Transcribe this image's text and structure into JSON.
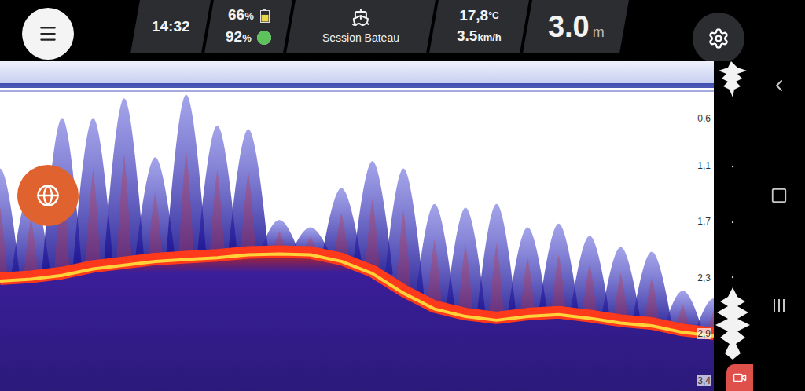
{
  "status_bar": {
    "time": "14:32",
    "phone_battery": {
      "value": "66",
      "unit": "%",
      "level": 0.66,
      "color": "#e8d44d"
    },
    "sonar_battery": {
      "value": "92",
      "unit": "%",
      "level": 0.92,
      "color": "#5cc25a"
    },
    "session": {
      "label": "Session Bateau"
    },
    "temperature": {
      "value": "17,8",
      "unit": "°C"
    },
    "speed": {
      "value": "3.5",
      "unit": "km/h"
    },
    "depth": {
      "value": "3.0",
      "unit": "m"
    }
  },
  "sonar": {
    "depth_scale": [
      "0,6",
      "1,1",
      "1,7",
      "2,3",
      "2,9",
      "3,4"
    ],
    "bottom": [
      2.31,
      2.29,
      2.25,
      2.18,
      2.14,
      2.1,
      2.08,
      2.06,
      2.03,
      2.02,
      2.03,
      2.1,
      2.23,
      2.44,
      2.61,
      2.69,
      2.73,
      2.69,
      2.67,
      2.71,
      2.76,
      2.79,
      2.86,
      2.9
    ],
    "vegetation": [
      1.13,
      1.34,
      0.59,
      0.59,
      0.38,
      1.01,
      0.34,
      0.67,
      0.71,
      1.68,
      1.76,
      1.34,
      1.05,
      1.13,
      1.51,
      1.55,
      1.51,
      1.76,
      1.72,
      1.85,
      1.97,
      2.02,
      2.44,
      2.52
    ]
  }
}
